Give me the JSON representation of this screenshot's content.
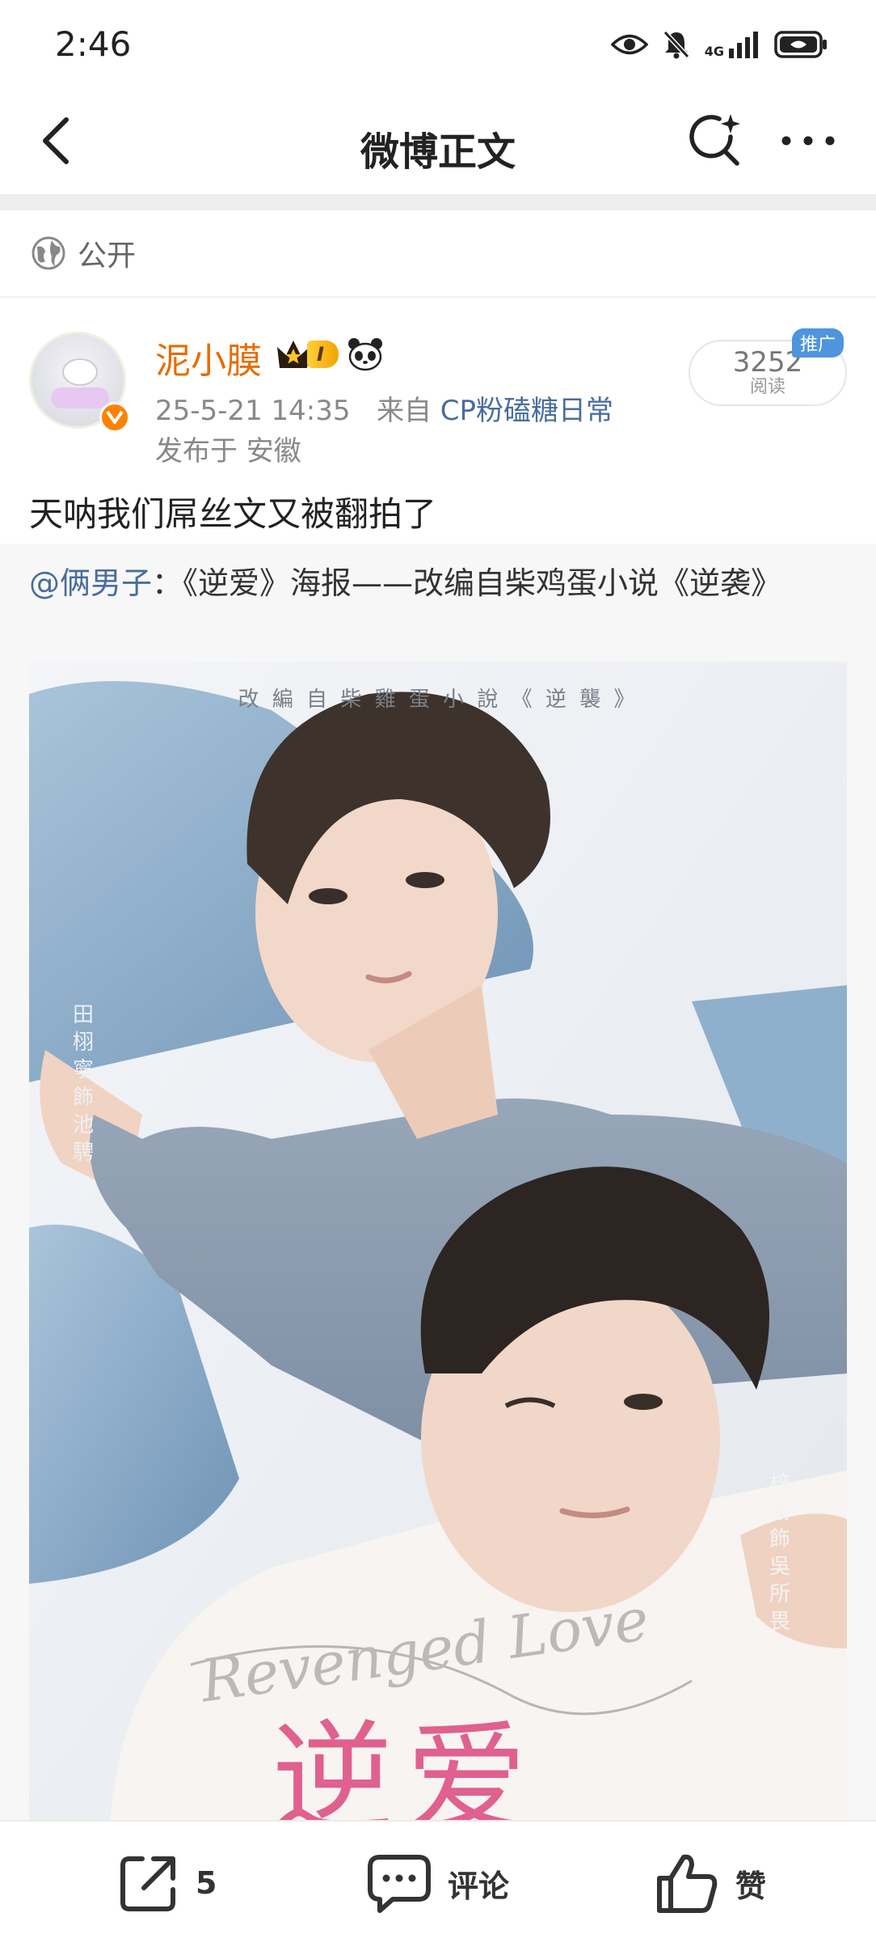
{
  "status_bar": {
    "time": "2:46",
    "network": "4G",
    "icons": [
      "eye-icon",
      "bell-off-icon",
      "signal-icon",
      "battery-icon"
    ]
  },
  "nav": {
    "title": "微博正文",
    "icons": [
      "back-arrow-icon",
      "search-sparkle-icon",
      "more-icon"
    ]
  },
  "visibility": {
    "label": "公开",
    "icon": "globe-icon"
  },
  "post": {
    "author": {
      "name": "泥小膜",
      "level_badge": "I",
      "badge_icons": [
        "crown-icon",
        "panda-icon"
      ],
      "verified": true
    },
    "timestamp": "25-5-21 14:35",
    "source_prefix": "来自",
    "source": "CP粉磕糖日常",
    "location": "发布于 安徽",
    "read_count": "3252",
    "read_label": "阅读",
    "promo_tag": "推广",
    "text": "天呐我们屌丝文又被翻拍了",
    "repost": {
      "mention": "@俩男子",
      "separator": "：",
      "text": "《逆爱》海报——改编自柴鸡蛋小说《逆袭》",
      "image": {
        "top_caption": "改 編 自 柴 雞 蛋 小 說 《 逆 襲 》",
        "left_credit": "田栩寧 飾 池騁",
        "right_credit": "梓渝 飾 吳所畏",
        "title_cn": "逆爱",
        "title_en": "Revenged Love"
      }
    }
  },
  "actions": {
    "repost_count": "5",
    "comment_label": "评论",
    "like_label": "赞"
  },
  "colors": {
    "username": "#e86c00",
    "link": "#4a6d9c",
    "verified": "#ff8200",
    "promo": "#4e95dd"
  }
}
